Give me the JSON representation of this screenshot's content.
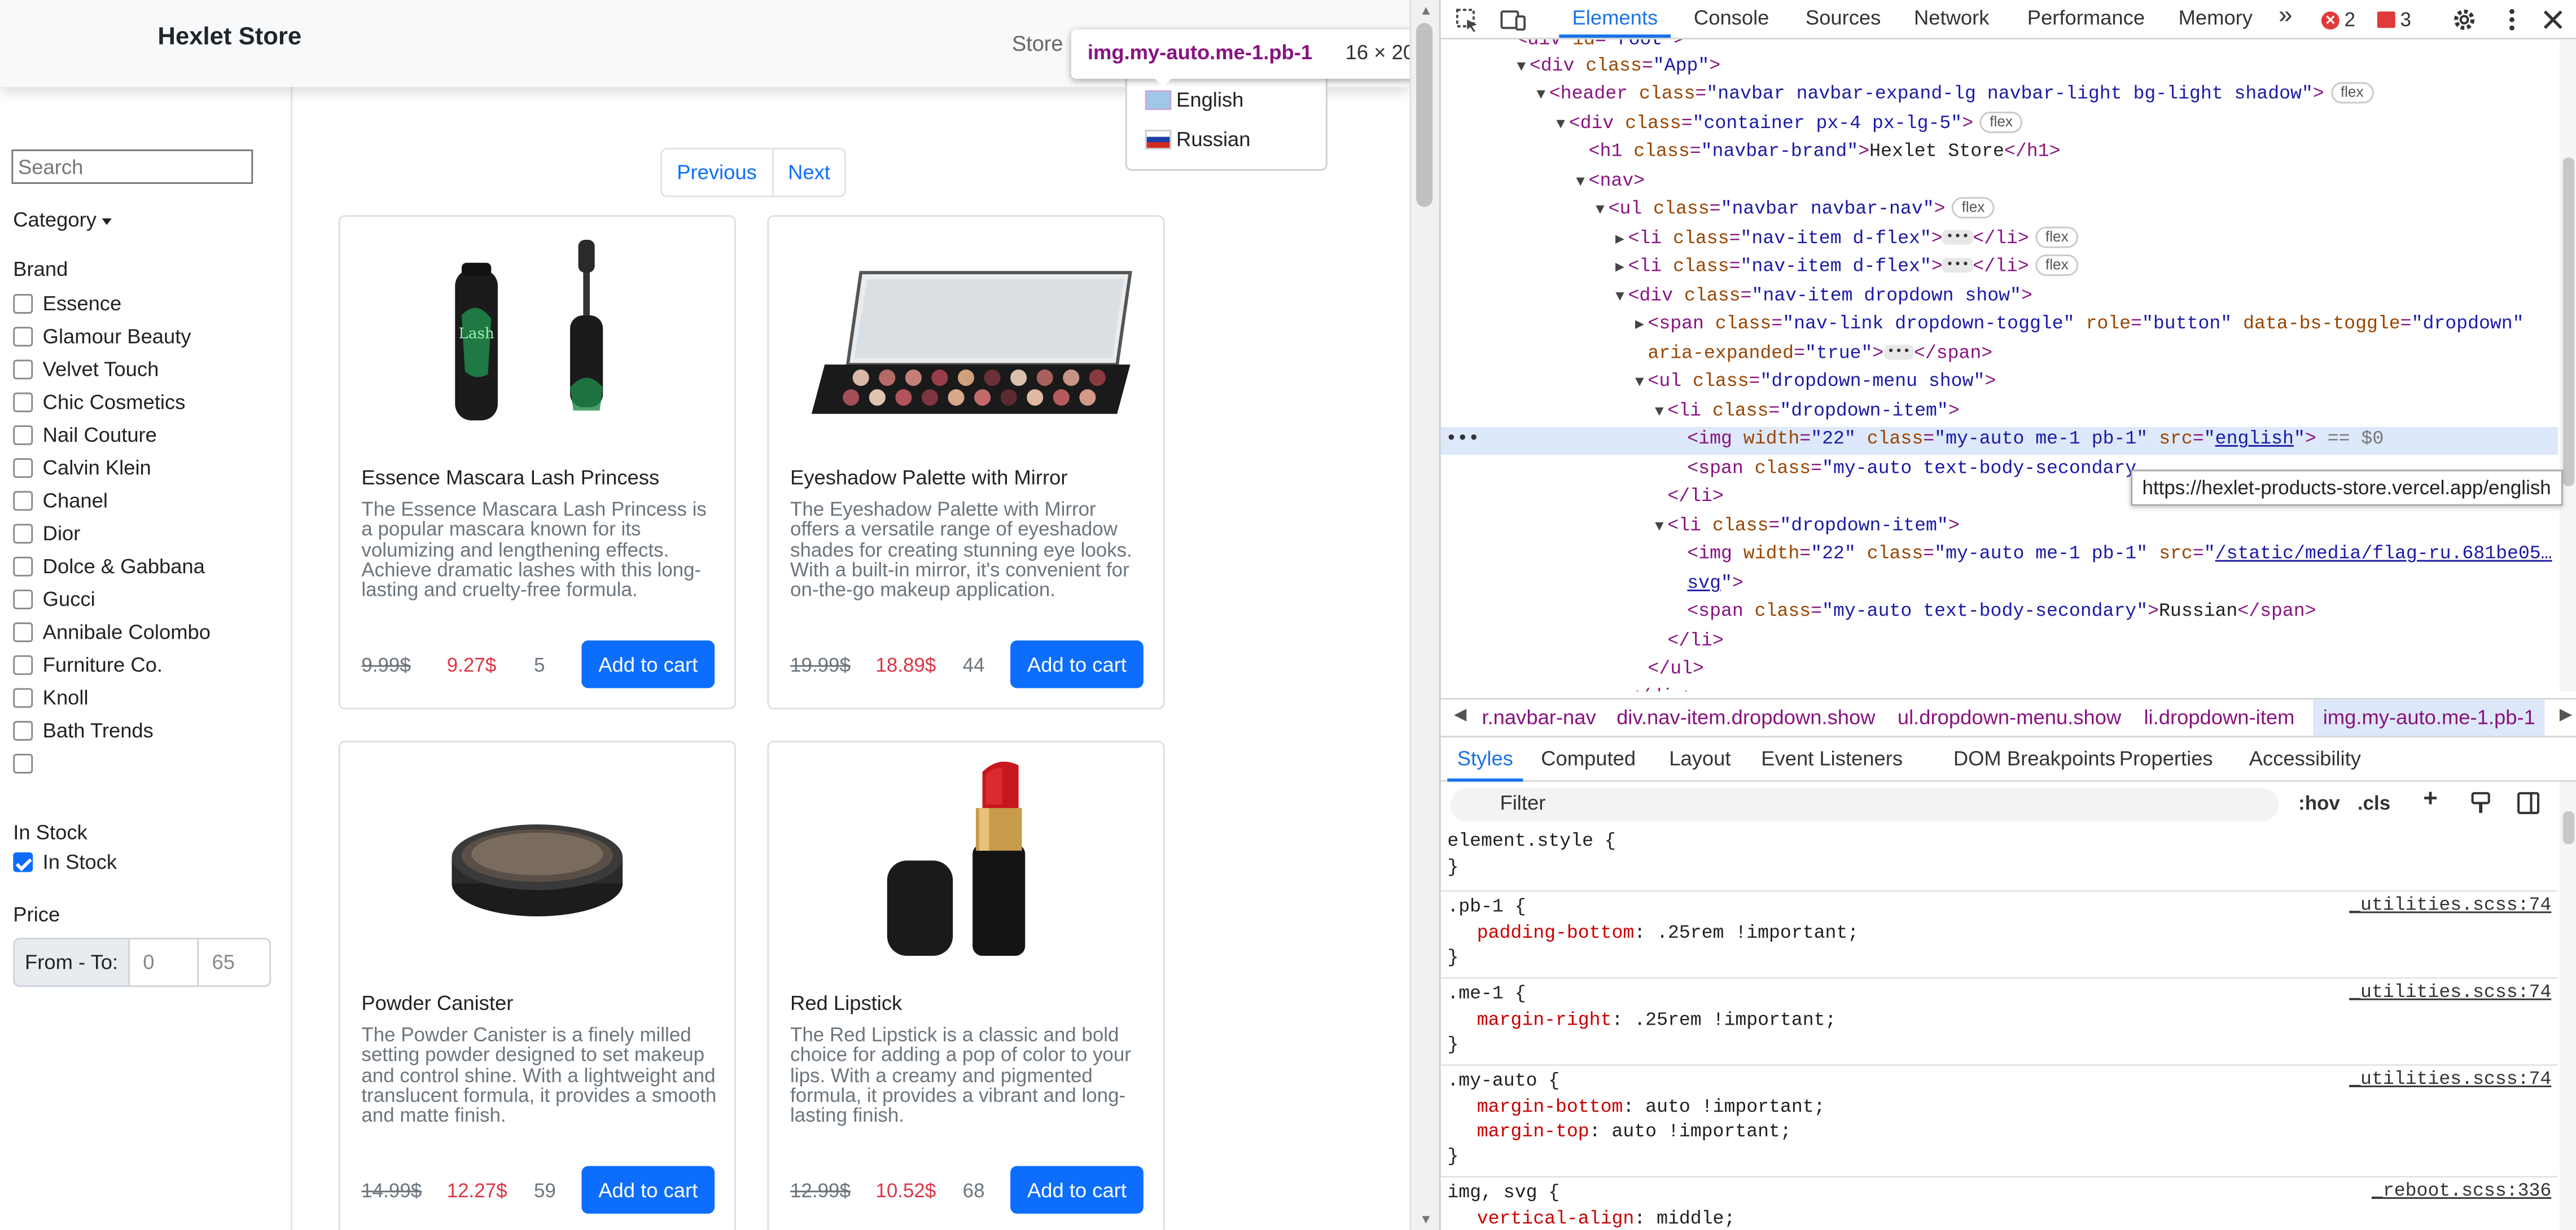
{
  "header": {
    "brand": "Hexlet Store",
    "store_link": "Store"
  },
  "tooltip": {
    "element": "img.my-auto.me-1.pb-1",
    "size": "16 × 20"
  },
  "language_menu": {
    "items": [
      {
        "label": "English",
        "flag": "flag-en"
      },
      {
        "label": "Russian",
        "flag": "flag-ru"
      }
    ]
  },
  "sidebar": {
    "search_placeholder": "Search",
    "category_label": "Category",
    "brand_heading": "Brand",
    "brands": [
      "Essence",
      "Glamour Beauty",
      "Velvet Touch",
      "Chic Cosmetics",
      "Nail Couture",
      "Calvin Klein",
      "Chanel",
      "Dior",
      "Dolce & Gabbana",
      "Gucci",
      "Annibale Colombo",
      "Furniture Co.",
      "Knoll",
      "Bath Trends",
      ""
    ],
    "stock_heading": "In Stock",
    "stock_label": "In Stock",
    "stock_checked": true,
    "price_heading": "Price",
    "price_label": "From - To:",
    "price_from": "0",
    "price_to": "65"
  },
  "pagination": {
    "previous": "Previous",
    "next": "Next"
  },
  "products": [
    {
      "title": "Essence Mascara Lash Princess",
      "description": "The Essence Mascara Lash Princess is a popular mascara known for its volumizing and lengthening effects. Achieve dramatic lashes with this long-lasting and cruelty-free formula.",
      "old_price": "9.99$",
      "price": "9.27$",
      "qty": "5",
      "button": "Add to cart",
      "image": "mascara-image"
    },
    {
      "title": "Eyeshadow Palette with Mirror",
      "description": "The Eyeshadow Palette with Mirror offers a versatile range of eyeshadow shades for creating stunning eye looks. With a built-in mirror, it's convenient for on-the-go makeup application.",
      "old_price": "19.99$",
      "price": "18.89$",
      "qty": "44",
      "button": "Add to cart",
      "image": "palette-image"
    },
    {
      "title": "Powder Canister",
      "description": "The Powder Canister is a finely milled setting powder designed to set makeup and control shine. With a lightweight and translucent formula, it provides a smooth and matte finish.",
      "old_price": "14.99$",
      "price": "12.27$",
      "qty": "59",
      "button": "Add to cart",
      "image": "powder-image"
    },
    {
      "title": "Red Lipstick",
      "description": "The Red Lipstick is a classic and bold choice for adding a pop of color to your lips. With a creamy and pigmented formula, it provides a vibrant and long-lasting finish.",
      "old_price": "12.99$",
      "price": "10.52$",
      "qty": "68",
      "button": "Add to cart",
      "image": "lipstick-image"
    }
  ],
  "devtools": {
    "tabs": [
      "Elements",
      "Console",
      "Sources",
      "Network",
      "Performance",
      "Memory"
    ],
    "more_tabs": "»",
    "errors": "2",
    "issues": "3",
    "url_tooltip": "https://hexlet-products-store.vercel.app/english",
    "breadcrumbs": [
      "r.navbar-nav",
      "div.nav-item.dropdown.show",
      "ul.dropdown-menu.show",
      "li.dropdown-item",
      "img.my-auto.me-1.pb-1"
    ],
    "style_tabs": [
      "Styles",
      "Computed",
      "Layout",
      "Event Listeners",
      "DOM Breakpoints",
      "Properties",
      "Accessibility"
    ],
    "filter_placeholder": "Filter",
    "hov": ":hov",
    "cls": ".cls",
    "rules": [
      {
        "selector": "element.style {",
        "props": [],
        "source": ""
      },
      {
        "selector": ".pb-1 {",
        "props": [
          {
            "name": "padding-bottom",
            "value": ".25rem !important;"
          }
        ],
        "source": "_utilities.scss:74"
      },
      {
        "selector": ".me-1 {",
        "props": [
          {
            "name": "margin-right",
            "value": ".25rem !important;"
          }
        ],
        "source": "_utilities.scss:74"
      },
      {
        "selector": ".my-auto {",
        "props": [
          {
            "name": "margin-bottom",
            "value": "auto !important;"
          },
          {
            "name": "margin-top",
            "value": "auto !important;"
          }
        ],
        "source": "_utilities.scss:74"
      },
      {
        "selector": "img, svg {",
        "props": [
          {
            "name": "vertical-align",
            "value": "middle;"
          }
        ],
        "source": "_reboot.scss:336"
      }
    ]
  }
}
